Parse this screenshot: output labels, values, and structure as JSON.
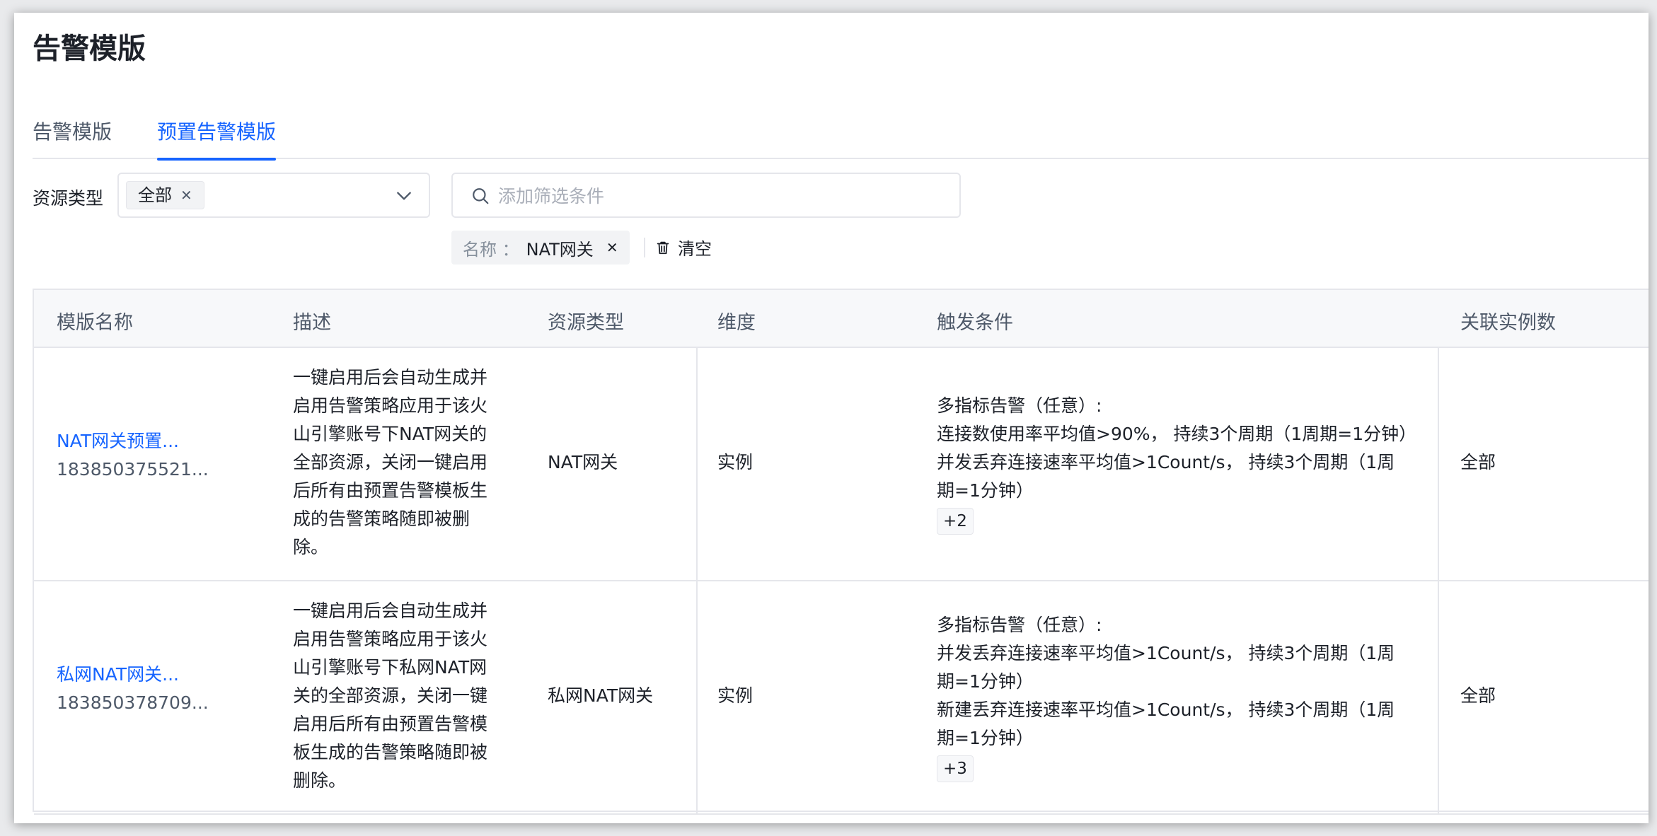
{
  "page": {
    "title": "告警模版"
  },
  "tabs": [
    {
      "label": "告警模版",
      "active": false
    },
    {
      "label": "预置告警模版",
      "active": true
    }
  ],
  "filters": {
    "resource_type_label": "资源类型",
    "resource_type_chip": "全部",
    "search_placeholder": "添加筛选条件",
    "active_tag_key": "名称 ：",
    "active_tag_value": "NAT网关",
    "clear_label": "清空"
  },
  "table": {
    "columns": [
      "模版名称",
      "描述",
      "资源类型",
      "维度",
      "触发条件",
      "关联实例数"
    ],
    "rows": [
      {
        "name": "NAT网关预置...",
        "id": "183850375521...",
        "description_lines": [
          "一键启用后会自动生成并",
          "启用告警策略应用于该火",
          "山引擎账号下NAT网关的",
          "全部资源，关闭一键启用",
          "后所有由预置告警模板生",
          "成的告警策略随即被删",
          "除。"
        ],
        "resource_type": "NAT网关",
        "dimension": "实例",
        "condition_lines": [
          "多指标告警（任意）:",
          "连接数使用率平均值>90%， 持续3个周期（1周期=1分钟）",
          "并发丢弃连接速率平均值>1Count/s， 持续3个周期（1周",
          "期=1分钟）"
        ],
        "more": "+2",
        "instances": "全部"
      },
      {
        "name": "私网NAT网关...",
        "id": "183850378709...",
        "description_lines": [
          "一键启用后会自动生成并",
          "启用告警策略应用于该火",
          "山引擎账号下私网NAT网",
          "关的全部资源，关闭一键",
          "启用后所有由预置告警模",
          "板生成的告警策略随即被",
          "删除。"
        ],
        "resource_type": "私网NAT网关",
        "dimension": "实例",
        "condition_lines": [
          "多指标告警（任意）:",
          "并发丢弃连接速率平均值>1Count/s， 持续3个周期（1周",
          "期=1分钟）",
          "新建丢弃连接速率平均值>1Count/s， 持续3个周期（1周",
          "期=1分钟）"
        ],
        "more": "+3",
        "instances": "全部"
      }
    ]
  },
  "colors": {
    "accent": "#1664ff",
    "border": "#e5e6eb",
    "header_bg": "#f7f8fa"
  },
  "icons": {
    "search": "search-icon",
    "chevron": "chevron-down-icon",
    "trash": "trash-icon",
    "close": "close-icon"
  }
}
